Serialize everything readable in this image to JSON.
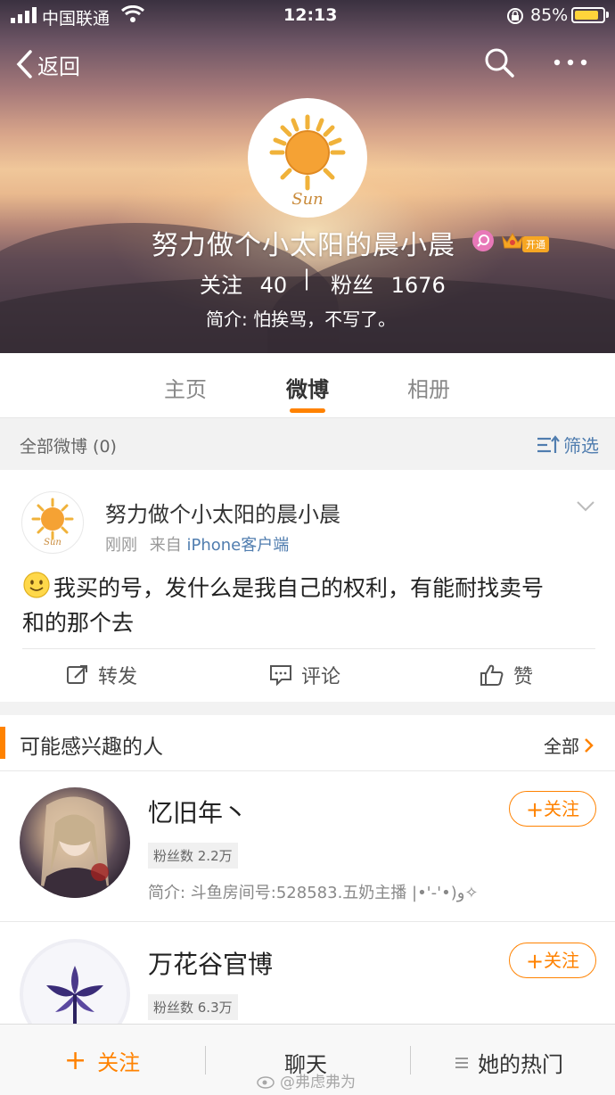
{
  "status_bar": {
    "carrier": "中国联通",
    "time": "12:13",
    "battery": "85%",
    "battery_level": 0.85
  },
  "nav": {
    "back_label": "返回"
  },
  "profile": {
    "name": "努力做个小太阳的晨小晨",
    "avatar_text": "Sun",
    "vip_label": "开通",
    "following_label": "关注",
    "following_count": "40",
    "divider": "|",
    "followers_label": "粉丝",
    "followers_count": "1676",
    "bio": "简介: 怕挨骂，不写了。"
  },
  "tabs": [
    {
      "label": "主页",
      "active": false
    },
    {
      "label": "微博",
      "active": true
    },
    {
      "label": "相册",
      "active": false
    }
  ],
  "filter": {
    "count_label": "全部微博 (0)",
    "filter_label": "筛选"
  },
  "post": {
    "author": "努力做个小太阳的晨小晨",
    "time": "刚刚",
    "from_label": "来自",
    "source": "iPhone客户端",
    "text_line1": "我买的号，发什么是我自己的权利，有能耐找卖号",
    "text_line2": "和的那个去",
    "actions": {
      "repost": "转发",
      "comment": "评论",
      "like": "赞"
    }
  },
  "suggest": {
    "title": "可能感兴趣的人",
    "all_label": "全部",
    "users": [
      {
        "name": "忆旧年丶",
        "fans": "粉丝数 2.2万",
        "bio": "简介:  斗鱼房间号:528583.五奶主播 |•'-'•)و✧",
        "follow": "关注"
      },
      {
        "name": "万花谷官博",
        "fans": "粉丝数 6.3万",
        "follow": "关注"
      }
    ]
  },
  "bottom": {
    "follow": "关注",
    "chat": "聊天",
    "hot": "她的热门"
  },
  "watermark": "@弗虑弗为",
  "colors": {
    "accent": "#ff8200",
    "link": "#507daf",
    "vip": "#f6a623"
  }
}
